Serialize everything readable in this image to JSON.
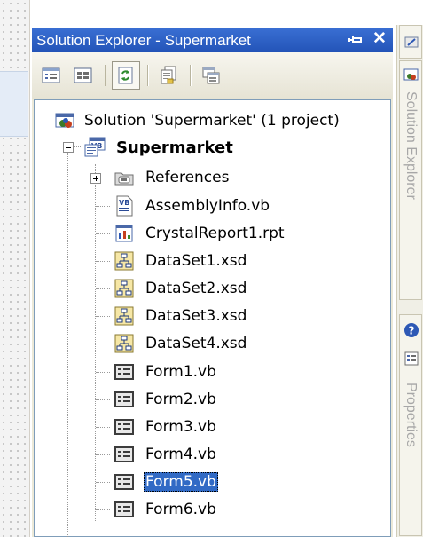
{
  "panel": {
    "title": "Solution Explorer - Supermarket",
    "pin_icon": "pin-icon",
    "close_icon": "close-icon",
    "close_glyph": "✕"
  },
  "toolbar": {
    "buttons": [
      {
        "name": "properties-icon"
      },
      {
        "name": "show-all-files-icon"
      },
      {
        "name": "refresh-icon"
      },
      {
        "name": "view-code-icon"
      },
      {
        "name": "view-designer-icon"
      }
    ]
  },
  "tree": {
    "solution": {
      "label": "Solution 'Supermarket' (1 project)",
      "icon": "solution-icon"
    },
    "project": {
      "label": "Supermarket",
      "icon": "vb-project-icon",
      "expanded": true
    },
    "items": [
      {
        "label": "References",
        "icon": "references-icon",
        "collapsed": true
      },
      {
        "label": "AssemblyInfo.vb",
        "icon": "vb-file-icon"
      },
      {
        "label": "CrystalReport1.rpt",
        "icon": "crystal-report-icon"
      },
      {
        "label": "DataSet1.xsd",
        "icon": "dataset-icon"
      },
      {
        "label": "DataSet2.xsd",
        "icon": "dataset-icon"
      },
      {
        "label": "DataSet3.xsd",
        "icon": "dataset-icon"
      },
      {
        "label": "DataSet4.xsd",
        "icon": "dataset-icon"
      },
      {
        "label": "Form1.vb",
        "icon": "form-icon"
      },
      {
        "label": "Form2.vb",
        "icon": "form-icon"
      },
      {
        "label": "Form3.vb",
        "icon": "form-icon"
      },
      {
        "label": "Form4.vb",
        "icon": "form-icon"
      },
      {
        "label": "Form5.vb",
        "icon": "form-icon",
        "selected": true
      },
      {
        "label": "Form6.vb",
        "icon": "form-icon"
      }
    ]
  },
  "side_tabs": {
    "solution_explorer": "Solution Explorer",
    "properties": "Properties"
  },
  "colors": {
    "title_bar": "#2a5cc2",
    "selection": "#316ac5"
  }
}
